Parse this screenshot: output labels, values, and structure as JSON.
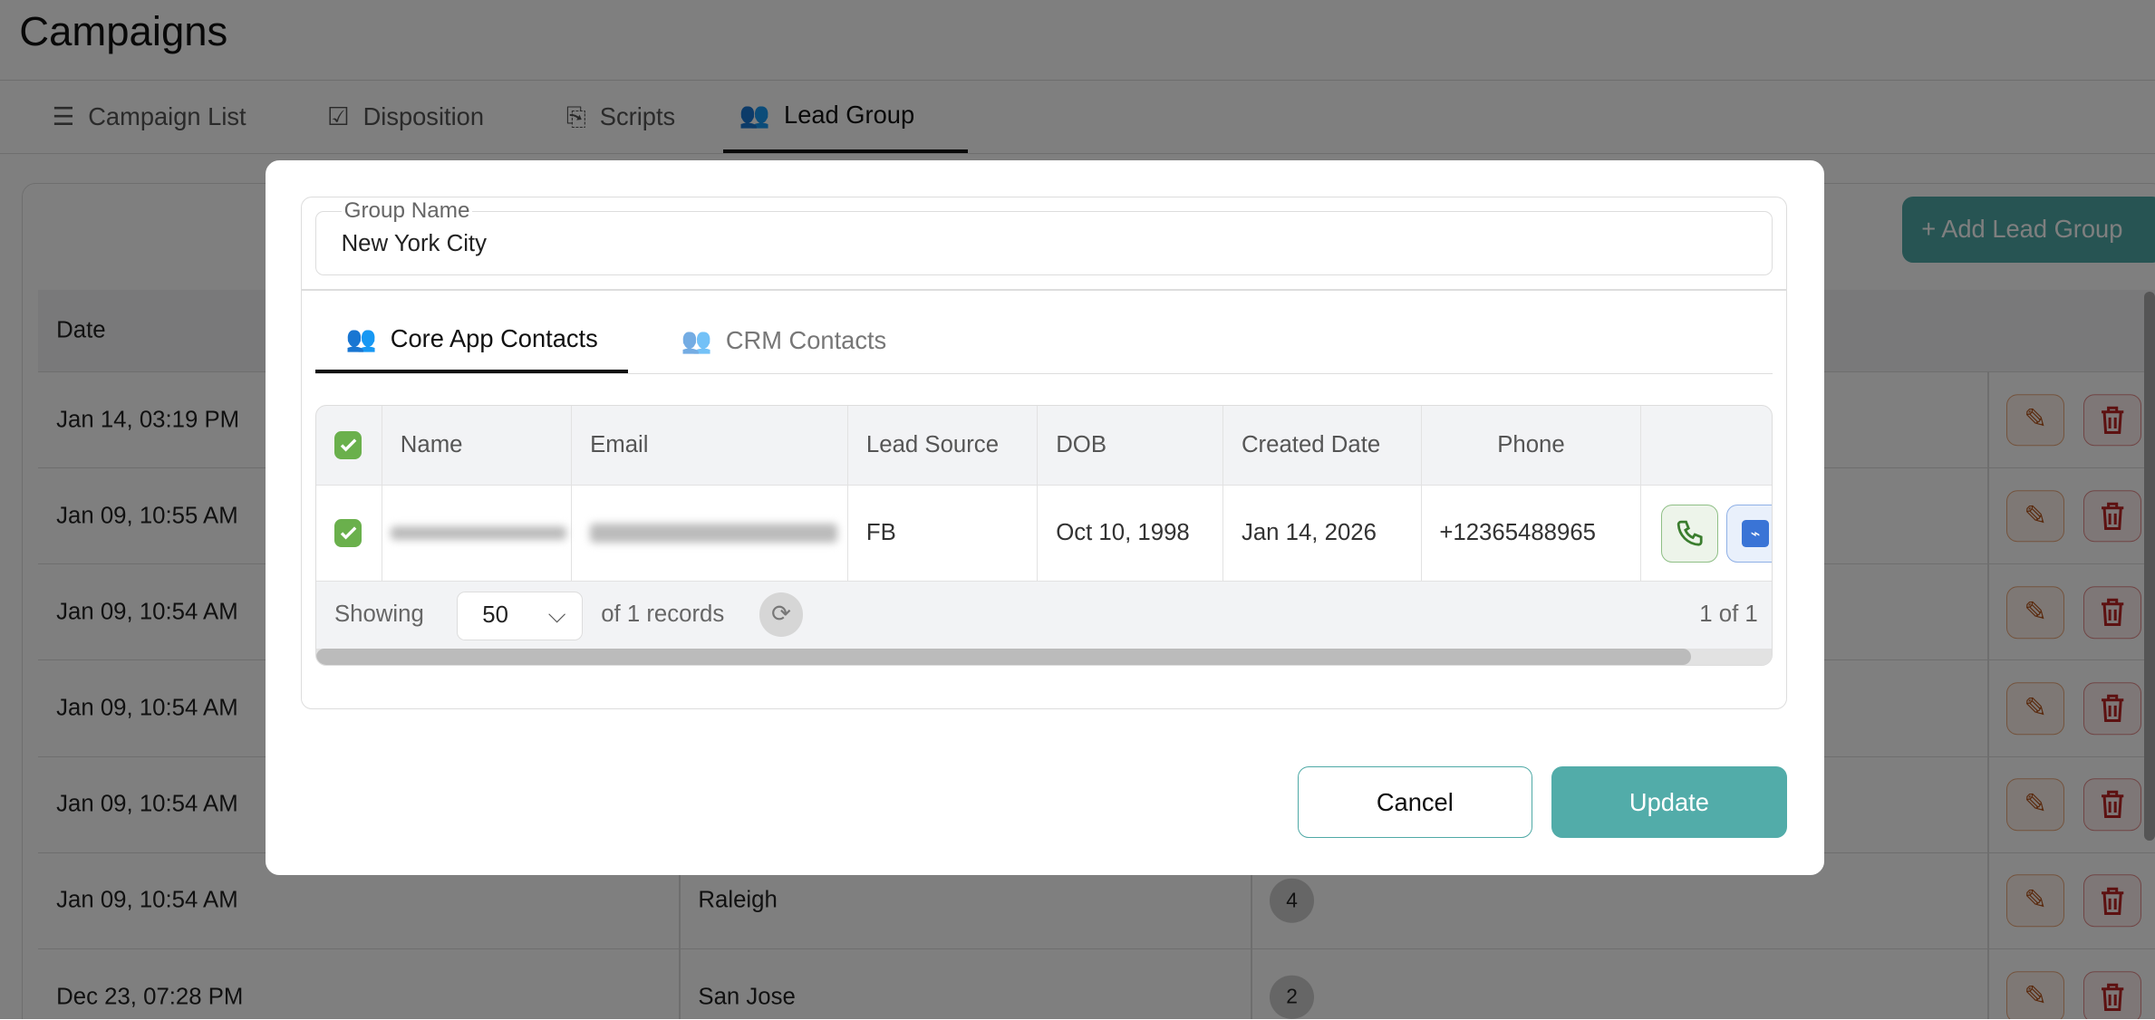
{
  "page": {
    "title": "Campaigns",
    "tabs": [
      {
        "label": "Campaign List"
      },
      {
        "label": "Disposition"
      },
      {
        "label": "Scripts"
      },
      {
        "label": "Lead Group"
      }
    ],
    "add_button": "+ Add Lead Group",
    "table": {
      "headers": {
        "date": "Date"
      },
      "rows": [
        {
          "date": "Jan 14, 03:19 PM",
          "name": "",
          "count": ""
        },
        {
          "date": "Jan 09, 10:55 AM",
          "name": "",
          "count": ""
        },
        {
          "date": "Jan 09, 10:54 AM",
          "name": "",
          "count": ""
        },
        {
          "date": "Jan 09, 10:54 AM",
          "name": "",
          "count": ""
        },
        {
          "date": "Jan 09, 10:54 AM",
          "name": "",
          "count": ""
        },
        {
          "date": "Jan 09, 10:54 AM",
          "name": "Raleigh",
          "count": "4"
        },
        {
          "date": "Dec 23, 07:28 PM",
          "name": "San Jose",
          "count": "2"
        }
      ]
    }
  },
  "modal": {
    "group_name_label": "Group Name",
    "group_name_value": "New York City",
    "tabs": [
      {
        "label": "Core App Contacts"
      },
      {
        "label": "CRM Contacts"
      }
    ],
    "grid": {
      "headers": [
        "Name",
        "Email",
        "Lead Source",
        "DOB",
        "Created Date",
        "Phone"
      ],
      "rows": [
        {
          "lead_source": "FB",
          "dob": "Oct 10, 1998",
          "created": "Jan 14, 2026",
          "phone": "+12365488965"
        }
      ]
    },
    "footer": {
      "showing": "Showing",
      "page_size": "50",
      "records": "of 1 records",
      "pages": "1 of 1"
    },
    "cancel": "Cancel",
    "update": "Update"
  }
}
